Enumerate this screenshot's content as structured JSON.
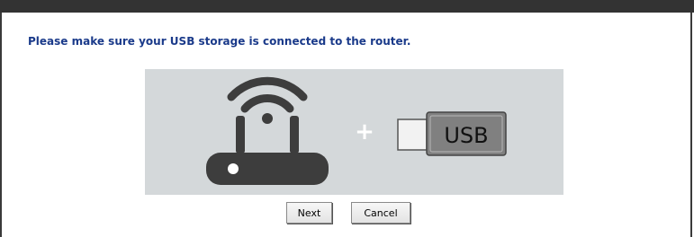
{
  "instruction": "Please make sure your USB storage is connected to the router.",
  "illustration": {
    "plus_sign": "+",
    "usb_label": "USB",
    "icons": [
      "router-icon",
      "plus-icon",
      "usb-drive-icon"
    ],
    "colors": {
      "background": "#d4d8da",
      "router": "#3d3d3d",
      "plus": "#ffffff",
      "usb_plug": "#f2f2f2",
      "usb_body": "#808080"
    }
  },
  "buttons": {
    "next_label": "Next",
    "cancel_label": "Cancel"
  },
  "colors": {
    "topbar": "#333333",
    "instruction_text": "#1a3a8a"
  }
}
